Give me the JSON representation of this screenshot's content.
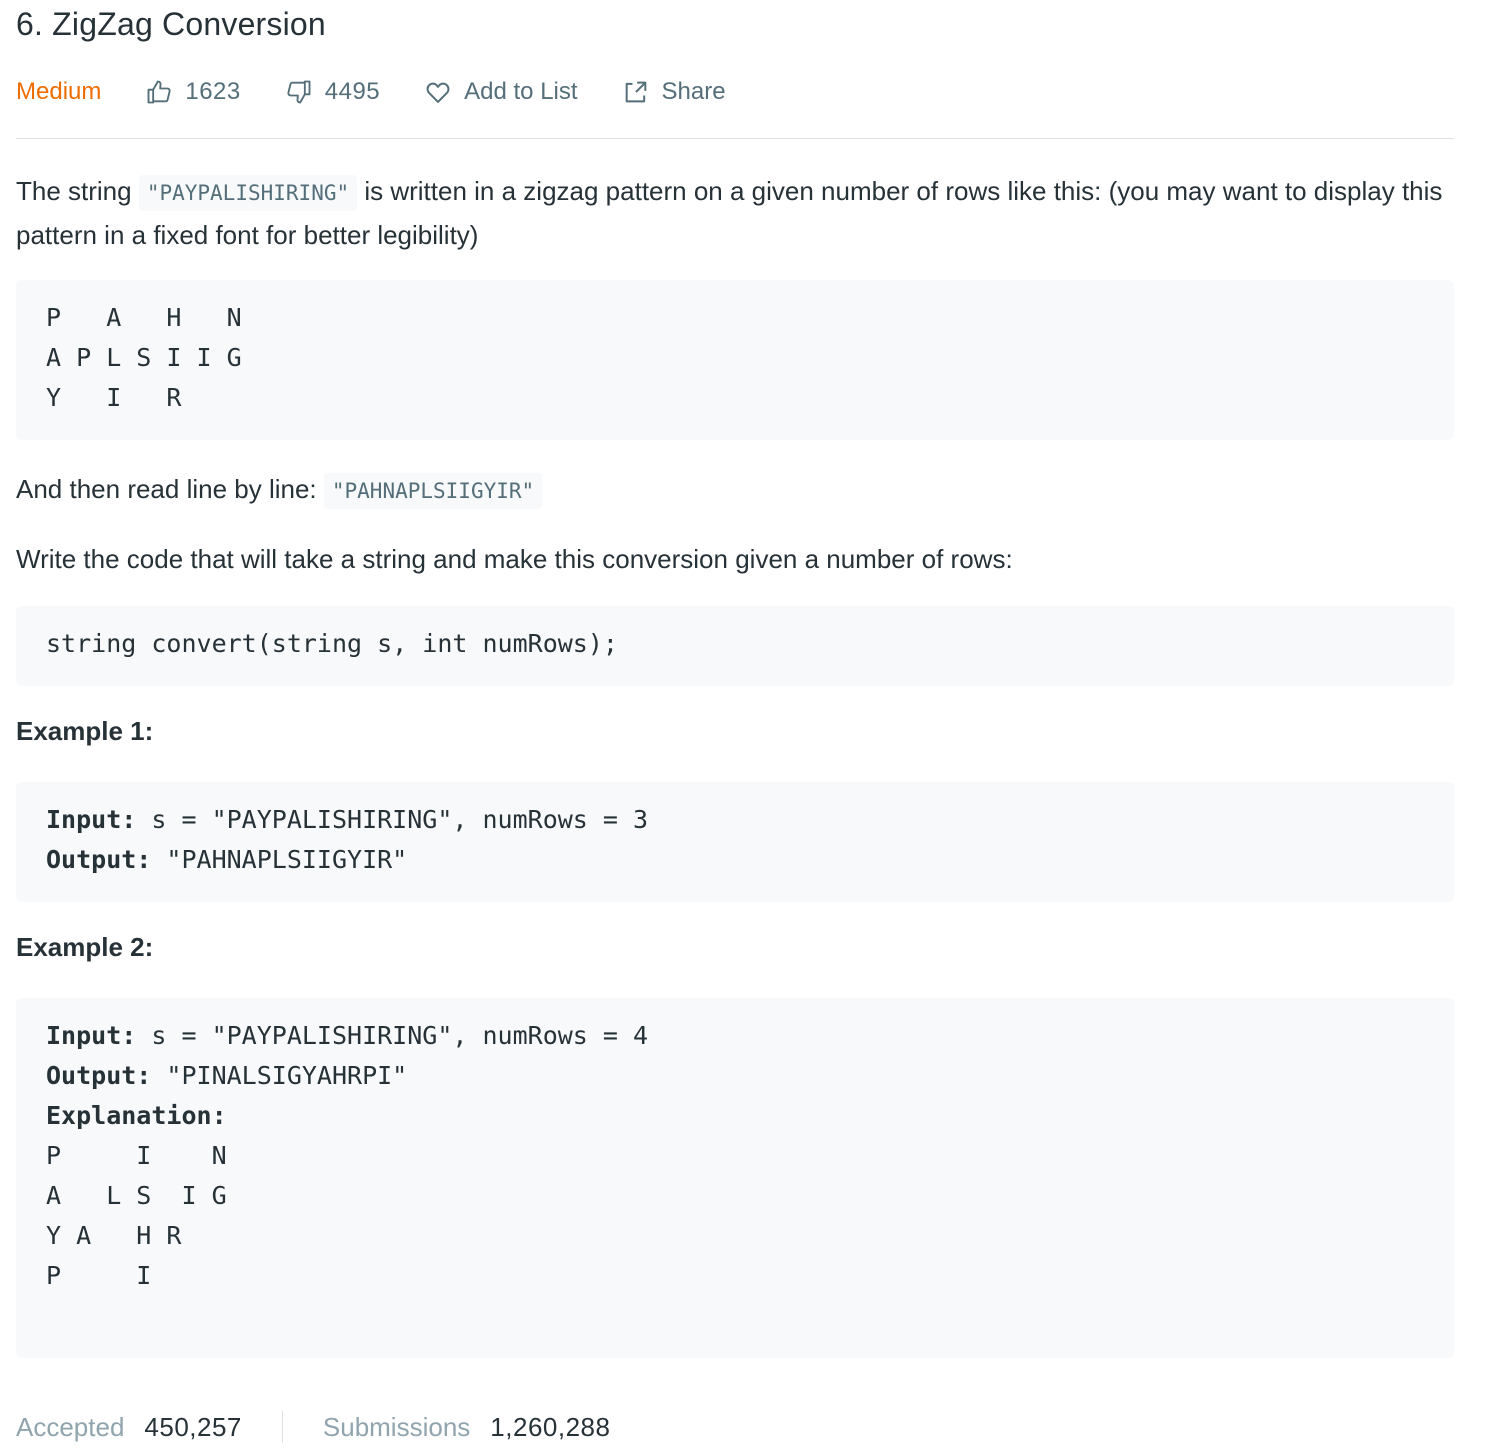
{
  "problem": {
    "title": "6. ZigZag Conversion",
    "difficulty": "Medium",
    "likes": "1623",
    "dislikes": "4495",
    "add_to_list_label": "Add to List",
    "share_label": "Share"
  },
  "description": {
    "p1_before": "The string ",
    "p1_code": "\"PAYPALISHIRING\"",
    "p1_after": " is written in a zigzag pattern on a given number of rows like this: (you may want to display this pattern in a fixed font for better legibility)",
    "pattern": "P   A   H   N\nA P L S I I G\nY   I   R",
    "p2_before": "And then read line by line: ",
    "p2_code": "\"PAHNAPLSIIGYIR\"",
    "p3": "Write the code that will take a string and make this conversion given a number of rows:",
    "signature": "string convert(string s, int numRows);"
  },
  "examples": [
    {
      "title": "Example 1:",
      "input_label": "Input:",
      "input_value": " s = \"PAYPALISHIRING\", numRows = 3",
      "output_label": "Output:",
      "output_value": " \"PAHNAPLSIIGYIR\""
    },
    {
      "title": "Example 2:",
      "input_label": "Input:",
      "input_value": " s = \"PAYPALISHIRING\", numRows = 4",
      "output_label": "Output:",
      "output_value": " \"PINALSIGYAHRPI\"",
      "explanation_label": "Explanation:",
      "explanation_pattern": "\nP     I    N\nA   L S  I G\nY A   H R\nP     I"
    }
  ],
  "stats": {
    "accepted_label": "Accepted",
    "accepted_value": "450,257",
    "submissions_label": "Submissions",
    "submissions_value": "1,260,288"
  },
  "colors": {
    "difficulty_medium": "#ef6c00",
    "text": "#263238",
    "muted": "#546e7a",
    "code_bg": "#f7f9fa"
  }
}
